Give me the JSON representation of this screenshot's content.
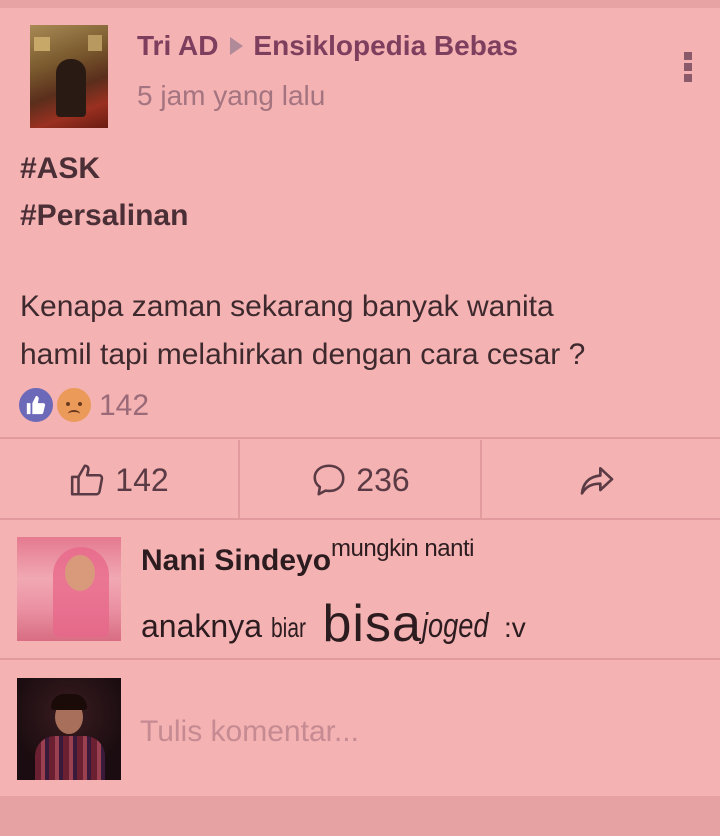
{
  "post": {
    "author": "Tri AD",
    "group": "Ensiklopedia Bebas",
    "time": "5 jam yang lalu",
    "hashtags": [
      "#ASK",
      "#Persalinan"
    ],
    "body_line1": "Kenapa zaman sekarang banyak wanita",
    "body_line2": "hamil tapi melahirkan dengan cara cesar ?",
    "reaction_count": "142",
    "reaction_icons": [
      "like-icon",
      "sad-icon"
    ]
  },
  "actions": {
    "like_count": "142",
    "comment_count": "236",
    "share_icon": "share-icon"
  },
  "comment": {
    "author": "Nani Sindeyo",
    "text_part1": "mungkin nanti",
    "text_part2a": "anaknya",
    "text_part2b": "biar",
    "text_part2c": "bisa",
    "text_part2d": "joged",
    "text_part2e": ":v"
  },
  "composer": {
    "placeholder": "Tulis komentar..."
  },
  "colors": {
    "background": "#f4b2b2",
    "divider": "#e19a9d",
    "header_text": "#7e3e5e",
    "like_reaction": "#6c69b8",
    "sad_reaction": "#eb9a5a"
  }
}
